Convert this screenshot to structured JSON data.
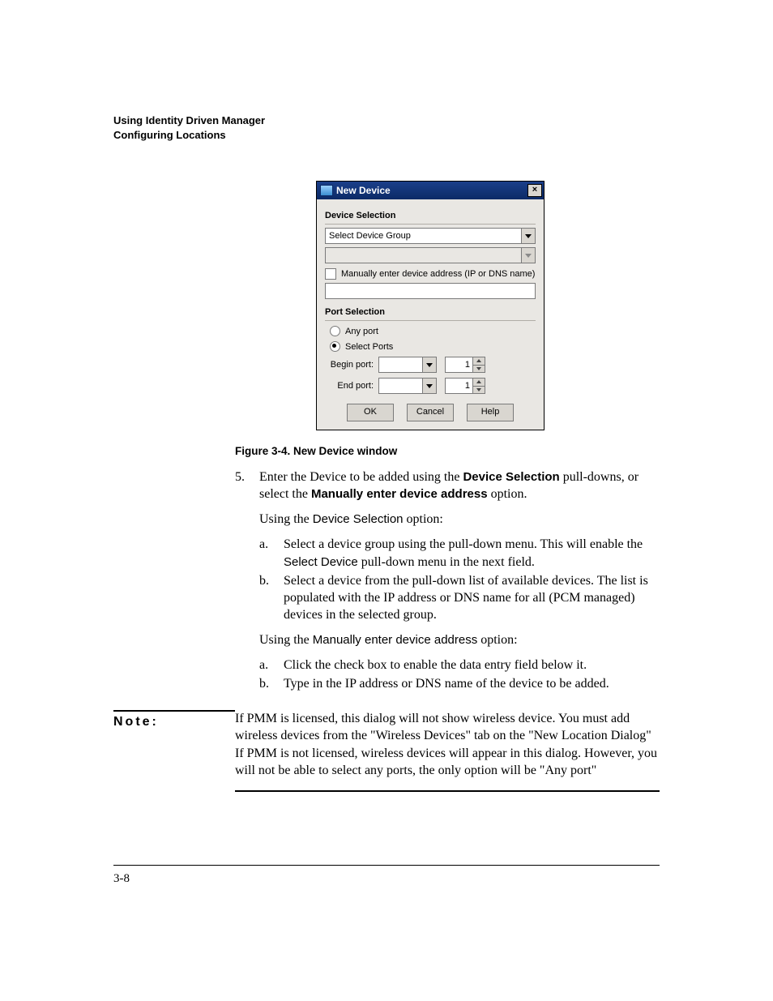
{
  "header": {
    "line1": "Using Identity Driven Manager",
    "line2": "Configuring Locations"
  },
  "dialog": {
    "title": "New Device",
    "sections": {
      "device_selection": {
        "legend": "Device Selection",
        "select_group_value": "Select Device Group",
        "manual_checkbox_label": "Manually enter device address (IP or DNS name)"
      },
      "port_selection": {
        "legend": "Port Selection",
        "any_port_label": "Any port",
        "select_ports_label": "Select Ports",
        "begin_label": "Begin port:",
        "end_label": "End port:",
        "begin_value": "1",
        "end_value": "1"
      }
    },
    "buttons": {
      "ok": "OK",
      "cancel": "Cancel",
      "help": "Help"
    }
  },
  "caption": "Figure 3-4. New Device window",
  "step": {
    "num": "5.",
    "text_a": "Enter the Device to be added using the ",
    "text_b": "Device Selection",
    "text_c": " pull-downs, or select the ",
    "text_d": "Manually enter device address",
    "text_e": " option."
  },
  "using_ds_a": "Using the ",
  "using_ds_b": "Device Selection",
  "using_ds_c": " option:",
  "ds_sub": {
    "a_num": "a.",
    "a_t1": "Select a device group using the pull-down menu. This will enable the ",
    "a_t2": "Select Device",
    "a_t3": " pull-down menu in the next field.",
    "b_num": "b.",
    "b": "Select a device from the pull-down list of available devices. The list is populated with the IP address or DNS name for all (PCM managed) devices in the selected group."
  },
  "using_me_a": "Using the ",
  "using_me_b": "Manually enter device address",
  "using_me_c": " option:",
  "me_sub": {
    "a_num": "a.",
    "a": "Click the check box to enable the data entry field below it.",
    "b_num": "b.",
    "b": "Type in the IP address or DNS name of the device to be added."
  },
  "note": {
    "label": "Note:",
    "body": "If PMM is licensed, this dialog will not show wireless device. You must add wireless devices from the \"Wireless Devices\" tab on the \"New Location Dialog\" If PMM is not licensed, wireless devices will appear in this dialog. However, you will not be able to select any ports, the only option will be \"Any port\""
  },
  "page_number": "3-8"
}
